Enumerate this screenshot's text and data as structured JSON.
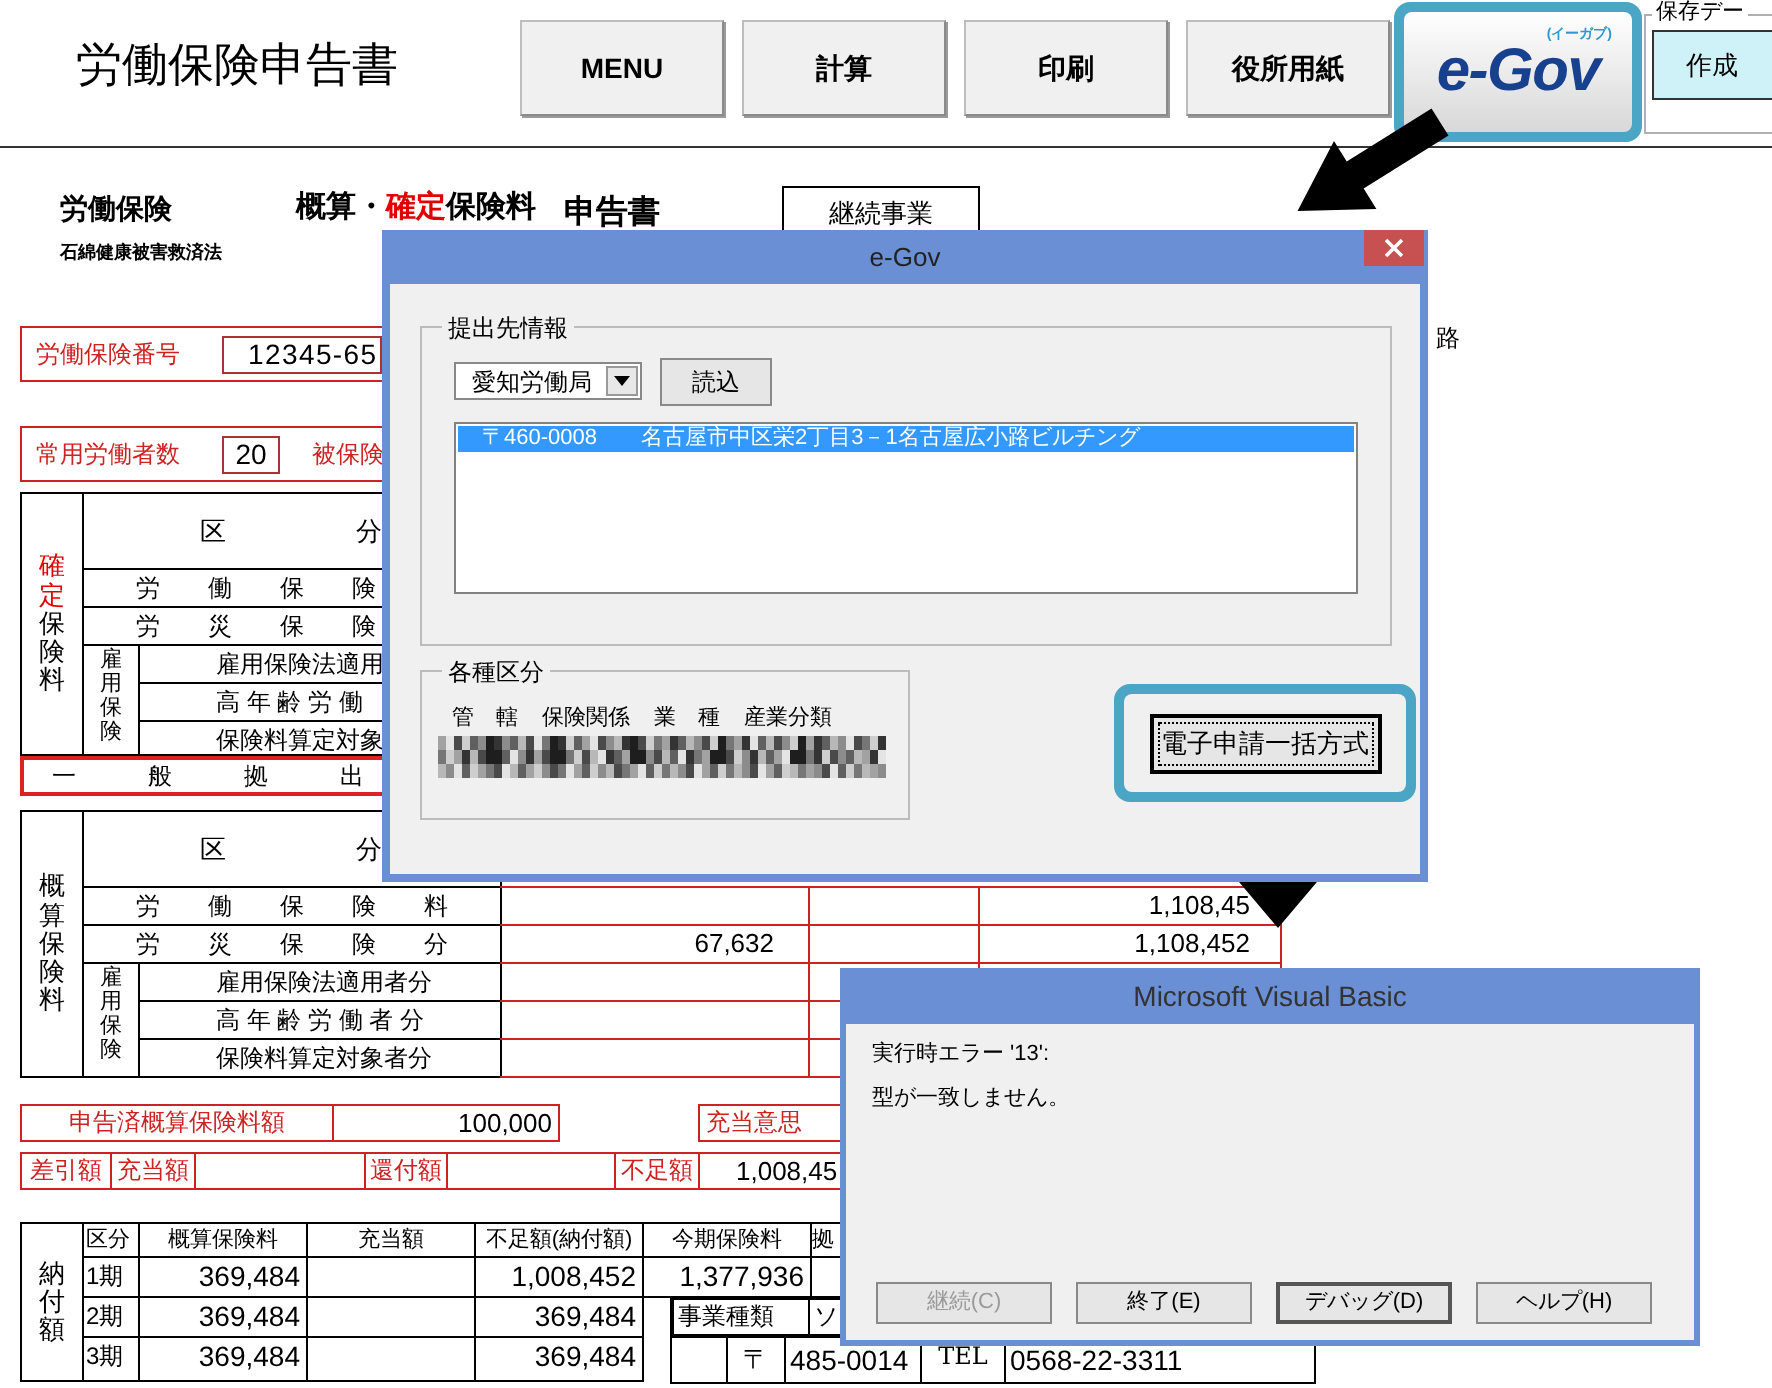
{
  "title": "労働保険申告書",
  "toolbar": {
    "buttons": [
      {
        "label": "MENU"
      },
      {
        "label": "計算"
      },
      {
        "label": "印刷"
      },
      {
        "label": "役所用紙"
      }
    ],
    "egov_button": {
      "text": "e-Gov",
      "ruby": "(イーガブ)",
      "highlighted": true
    },
    "save_group": {
      "legend": "保存デー",
      "button": "作成"
    }
  },
  "form": {
    "law_label": "労働保険",
    "law_sub": "石綿健康被害救済法",
    "form_title": {
      "prefix": "概算・",
      "emphasis": "確定",
      "suffix": "保険料"
    },
    "form_suffix": "申告書",
    "business_type": "継続事業",
    "address_fragment": "路",
    "insurance_number": {
      "label": "労働保険番号",
      "value": "12345-65"
    },
    "workers": {
      "label": "常用労働者数",
      "value": "20",
      "insured_label": "被保険"
    },
    "confirmed_table": {
      "side_emphasis": "確定",
      "side_rest": "保険料",
      "header": "区　　　　　分",
      "group_label": "雇用保険",
      "rows": [
        {
          "label": "労　　働　　保　　険",
          "kind": "main"
        },
        {
          "label": "労　　災　　保　　険",
          "kind": "main"
        },
        {
          "label": "雇用保険法適用",
          "kind": "group"
        },
        {
          "label": "高 年 齢 労 働",
          "kind": "group"
        },
        {
          "label": "保険料算定対象",
          "kind": "group"
        }
      ],
      "general_row": "一　　　般　　　拠　　　出"
    },
    "estimate_table": {
      "side": "概算保険料",
      "header": "区　　　　　分",
      "group_label": "雇用保険",
      "rows": [
        {
          "label": "労　　働　　保　　険　　料",
          "kind": "main",
          "column_1": "",
          "column_3": "1,108,45"
        },
        {
          "label": "労　　災　　保　　険　　分",
          "kind": "main",
          "column_1": "67,632",
          "column_3": "1,108,452"
        },
        {
          "label": "雇用保険法適用者分",
          "kind": "group",
          "column_1": "",
          "column_3": ""
        },
        {
          "label": "高 年 齢 労 働 者 分",
          "kind": "group",
          "column_1": "",
          "column_3": ""
        },
        {
          "label": "保険料算定対象者分",
          "kind": "group",
          "column_1": "",
          "column_3": ""
        }
      ]
    },
    "declared": {
      "label": "申告済概算保険料額",
      "value": "100,000",
      "intent_label": "充当意思"
    },
    "difference": {
      "diff_label": "差引額",
      "appropriation_label": "充当額",
      "refund_label": "還付額",
      "shortfall_label": "不足額",
      "shortfall_value": "1,008,45"
    },
    "payment_table": {
      "side": "納付額",
      "columns": [
        "区分",
        "概算保険料",
        "充当額",
        "不足額(納付額)",
        "今期保険料",
        "拠"
      ],
      "rows": [
        [
          "1期",
          "369,484",
          "",
          "1,008,452",
          "1,377,936"
        ],
        [
          "2期",
          "369,484",
          "",
          "369,484"
        ],
        [
          "3期",
          "369,484",
          "",
          "369,484"
        ]
      ]
    },
    "business": {
      "label": "事業種類",
      "value": "ソ"
    },
    "address": {
      "postal_mark": "〒",
      "postal_code": "485-0014",
      "tel_label": "TEL",
      "tel": "0568-22-3311"
    }
  },
  "egov_dialog": {
    "title": "e-Gov",
    "destination_legend": "提出先情報",
    "bureau": "愛知労働局",
    "load_button": "読込",
    "addresses": [
      {
        "text": "〒460-0008　　名古屋市中区栄2丁目3－1名古屋広小路ビルチング",
        "selected": true
      }
    ],
    "category_legend": "各種区分",
    "category_columns": [
      "管　轄",
      "保険関係",
      "業　種",
      "産業分類"
    ],
    "submit_button": {
      "label": "電子申請一括方式",
      "highlighted": true
    }
  },
  "vb_dialog": {
    "title": "Microsoft Visual Basic",
    "lines": [
      "実行時エラー '13':",
      "型が一致しません。"
    ],
    "buttons": [
      {
        "label": "継続(C)",
        "disabled": true,
        "default": false
      },
      {
        "label": "終了(E)",
        "disabled": false,
        "default": false
      },
      {
        "label": "デバッグ(D)",
        "disabled": false,
        "default": true
      },
      {
        "label": "ヘルプ(H)",
        "disabled": false,
        "default": false
      }
    ]
  }
}
